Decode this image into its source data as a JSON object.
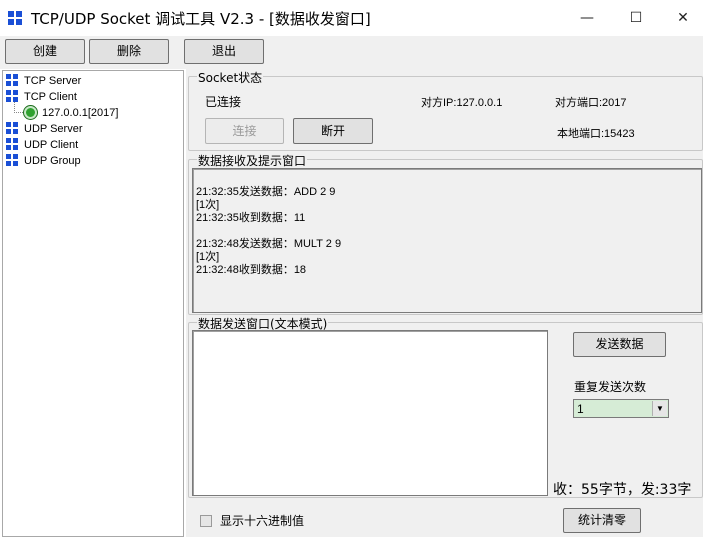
{
  "window": {
    "title": "TCP/UDP Socket 调试工具 V2.3 - [数据收发窗口]",
    "minimize": "—",
    "maximize": "☐",
    "close": "✕"
  },
  "toolbar": {
    "create_label": "创建",
    "delete_label": "删除",
    "exit_label": "退出"
  },
  "tree": {
    "items": [
      {
        "label": "TCP Server",
        "icon": "grid-icon"
      },
      {
        "label": "TCP Client",
        "icon": "grid-icon"
      },
      {
        "label": "127.0.0.1[2017]",
        "icon": "connection-icon"
      },
      {
        "label": "UDP Server",
        "icon": "grid-icon"
      },
      {
        "label": "UDP Client",
        "icon": "grid-icon"
      },
      {
        "label": "UDP Group",
        "icon": "grid-icon"
      }
    ]
  },
  "socket_status": {
    "title": "Socket状态",
    "state": "已连接",
    "remote_ip": "对方IP:127.0.0.1",
    "remote_port": "对方端口:2017",
    "local_port": "本地端口:15423",
    "connect_label": "连接",
    "disconnect_label": "断开"
  },
  "receive": {
    "title": "数据接收及提示窗口",
    "lines": [
      "21:32:35发送数据：ADD  2 9",
      "[1次]",
      "21:32:35收到数据：11",
      "",
      "21:32:48发送数据：MULT 2 9",
      "[1次]",
      "21:32:48收到数据：18"
    ]
  },
  "send": {
    "title": "数据发送窗口(文本模式)",
    "text": "",
    "send_label": "发送数据",
    "repeat_label": "重复发送次数",
    "repeat_value": "1",
    "stats": "收：55字节，发:33字",
    "hex_label": "显示十六进制值",
    "reset_label": "统计清零"
  },
  "colors": {
    "accent_icon": "#1a4fd6",
    "panel_bg": "#f0f0f0",
    "select_bg": "#d6ecd6",
    "connected_dot": "#2fa12f"
  }
}
